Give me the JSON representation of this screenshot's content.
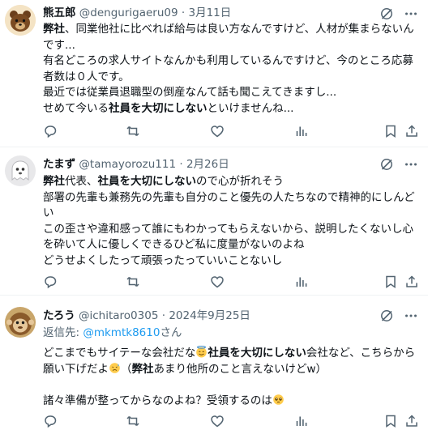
{
  "posts": [
    {
      "name": "熊五郎",
      "handle": "@dengurigaeru09",
      "dot": "·",
      "date": "3月11日",
      "avatar_icon": "brown-bear-avatar",
      "lines": [
        [
          {
            "t": "弊社",
            "b": true
          },
          {
            "t": "、同業他社に比べれば給与は良い方なんですけど、人材が集まらないん"
          }
        ],
        [
          {
            "t": "です..."
          }
        ],
        [
          {
            "t": "有名どころの求人サイトなんかも利用しているんですけど、今のところ応募"
          }
        ],
        [
          {
            "t": "者数は０人です。"
          }
        ],
        [
          {
            "t": "最近では従業員退職型の倒産なんて話も聞こえてきますし..."
          }
        ],
        [
          {
            "t": "せめて今いる"
          },
          {
            "t": "社員を大切にしない",
            "b": true
          },
          {
            "t": "といけませんね..."
          }
        ]
      ]
    },
    {
      "name": "たまず",
      "handle": "@tamayorozu111",
      "dot": "·",
      "date": "2月26日",
      "avatar_icon": "ghost-avatar",
      "lines": [
        [
          {
            "t": "弊社",
            "b": true
          },
          {
            "t": "代表、"
          },
          {
            "t": "社員を大切にしない",
            "b": true
          },
          {
            "t": "ので心が折れそう"
          }
        ],
        [
          {
            "t": "部署の先輩も兼務先の先輩も自分のこと優先の人たちなので精神的にしんど"
          }
        ],
        [
          {
            "t": "い"
          }
        ],
        [
          {
            "t": "この歪さや違和感って誰にもわかってもらえないから、説明したくないし心"
          }
        ],
        [
          {
            "t": "を砕いて人に優しくできるひど私に度量がないのよね"
          }
        ],
        [
          {
            "t": "どうせよくしたって頑張ったっていいことないし"
          }
        ]
      ]
    },
    {
      "name": "たろう",
      "handle": "@ichitaro0305",
      "dot": "·",
      "date": "2024年9月25日",
      "avatar_icon": "monkey-avatar",
      "reply_label": "返信先: ",
      "reply_handle": "@mkmtk8610",
      "reply_suffix": "さん",
      "lines": [
        [
          {
            "t": "どこまでもサイテーな会社だな"
          },
          {
            "emoji": "halo-smile"
          },
          {
            "t": "社員を大切にしない",
            "b": true
          },
          {
            "t": "会社など、こちらから"
          }
        ],
        [
          {
            "t": "願い下げだよ"
          },
          {
            "emoji": "sweat-face"
          },
          {
            "t": "（"
          },
          {
            "t": "弊社",
            "b": true
          },
          {
            "t": "あまり他所のこと言えないけどw）"
          }
        ],
        [
          {
            "t": ""
          }
        ],
        [
          {
            "t": "諸々準備が整ってからなのよね？受領するのは"
          },
          {
            "emoji": "pleading-face"
          }
        ]
      ]
    }
  ],
  "icons": {
    "grok": "grok-icon",
    "more": "more-icon",
    "reply": "reply-icon",
    "repost": "repost-icon",
    "like": "like-icon",
    "views": "views-icon",
    "bookmark": "bookmark-icon",
    "share": "share-icon"
  },
  "colors": {
    "text": "#0f1419",
    "muted": "#536471",
    "link": "#1d9bf0",
    "divider": "#eff3f4"
  }
}
